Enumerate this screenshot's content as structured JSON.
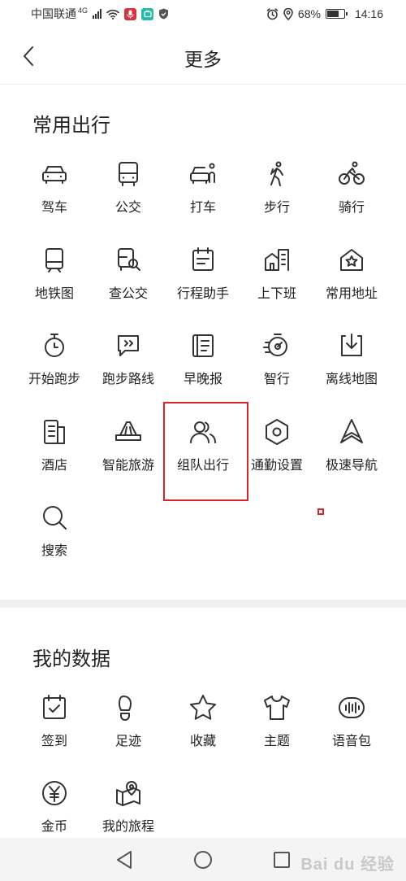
{
  "status_bar": {
    "carrier": "中国联通",
    "network": "4G",
    "battery": "68%",
    "battery_level": 0.68,
    "time": "14:16"
  },
  "header": {
    "title": "更多"
  },
  "sections": [
    {
      "title": "常用出行",
      "items": [
        {
          "label": "驾车",
          "icon": "car-icon"
        },
        {
          "label": "公交",
          "icon": "bus-icon"
        },
        {
          "label": "打车",
          "icon": "taxi-icon"
        },
        {
          "label": "步行",
          "icon": "walk-icon"
        },
        {
          "label": "骑行",
          "icon": "bike-icon"
        },
        {
          "label": "地铁图",
          "icon": "subway-icon"
        },
        {
          "label": "查公交",
          "icon": "bus-search-icon"
        },
        {
          "label": "行程助手",
          "icon": "trip-assistant-icon"
        },
        {
          "label": "上下班",
          "icon": "commute-icon"
        },
        {
          "label": "常用地址",
          "icon": "home-star-icon"
        },
        {
          "label": "开始跑步",
          "icon": "stopwatch-icon"
        },
        {
          "label": "跑步路线",
          "icon": "route-chat-icon"
        },
        {
          "label": "早晚报",
          "icon": "newspaper-icon"
        },
        {
          "label": "智行",
          "icon": "smart-travel-icon"
        },
        {
          "label": "离线地图",
          "icon": "download-map-icon"
        },
        {
          "label": "酒店",
          "icon": "hotel-icon"
        },
        {
          "label": "智能旅游",
          "icon": "tour-icon"
        },
        {
          "label": "组队出行",
          "icon": "team-icon"
        },
        {
          "label": "通勤设置",
          "icon": "hexagon-settings-icon"
        },
        {
          "label": "极速导航",
          "icon": "navigation-arrow-icon"
        },
        {
          "label": "搜索",
          "icon": "search-icon"
        }
      ]
    },
    {
      "title": "我的数据",
      "items": [
        {
          "label": "签到",
          "icon": "checkin-calendar-icon"
        },
        {
          "label": "足迹",
          "icon": "footprint-icon"
        },
        {
          "label": "收藏",
          "icon": "star-icon"
        },
        {
          "label": "主题",
          "icon": "tshirt-icon"
        },
        {
          "label": "语音包",
          "icon": "voice-pack-icon"
        },
        {
          "label": "金币",
          "icon": "coin-icon"
        },
        {
          "label": "我的旅程",
          "icon": "my-journey-icon"
        }
      ]
    }
  ],
  "watermark": "Bai du 经验",
  "colors": {
    "highlight": "#d8232a",
    "mic_badge": "#d9333f",
    "tv_badge": "#25b9a8"
  }
}
